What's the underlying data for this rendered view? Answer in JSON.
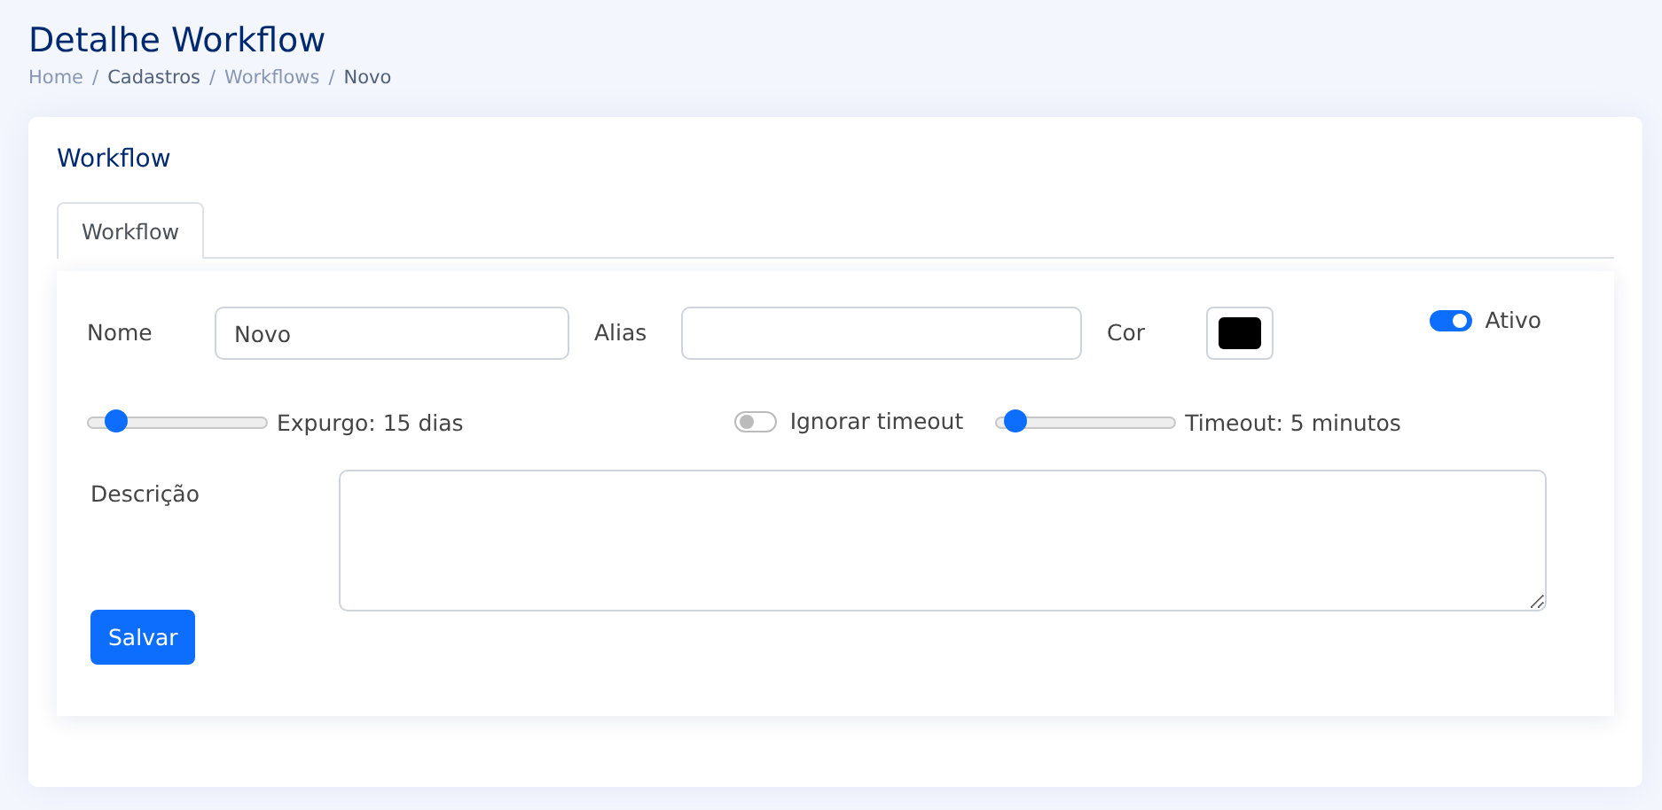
{
  "page_title": "Detalhe Workflow",
  "breadcrumb": [
    {
      "kind": "link",
      "label": "Home"
    },
    {
      "kind": "separator",
      "label": "/"
    },
    {
      "kind": "text",
      "label": "Cadastros"
    },
    {
      "kind": "separator",
      "label": "/"
    },
    {
      "kind": "link",
      "label": "Workflows"
    },
    {
      "kind": "separator",
      "label": "/"
    },
    {
      "kind": "text",
      "label": "Novo"
    }
  ],
  "card_title": "Workflow",
  "tabs": [
    {
      "label": "Workflow",
      "selected": true
    }
  ],
  "form": {
    "name_label": "Nome",
    "name_value": "Novo",
    "alias_label": "Alias",
    "color_label": "Cor",
    "color": "#000000",
    "active": {
      "label": "Ativo",
      "on": true
    },
    "purge": {
      "reading": "Expurgo: 15 dias",
      "level": 0.1
    },
    "ignore_timeout": {
      "label": "Ignorar timeout",
      "on": false
    },
    "timeout": {
      "reading": "Timeout: 5 minutos",
      "level": 0.05
    },
    "description_label": "Descrição"
  },
  "buttons": [
    {
      "label": "Salvar"
    }
  ]
}
